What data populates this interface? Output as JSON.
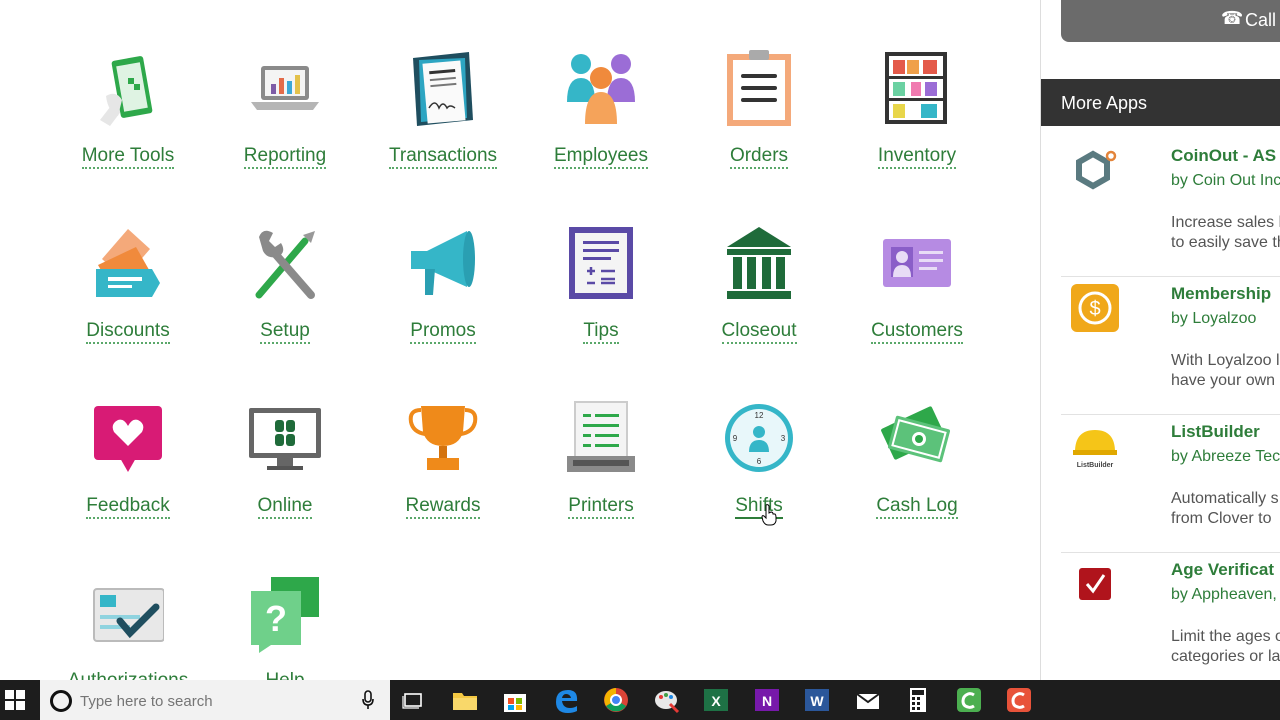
{
  "tools": [
    {
      "label": "More Tools"
    },
    {
      "label": "Reporting"
    },
    {
      "label": "Transactions"
    },
    {
      "label": "Employees"
    },
    {
      "label": "Orders"
    },
    {
      "label": "Inventory"
    },
    {
      "label": "Discounts"
    },
    {
      "label": "Setup"
    },
    {
      "label": "Promos"
    },
    {
      "label": "Tips"
    },
    {
      "label": "Closeout"
    },
    {
      "label": "Customers"
    },
    {
      "label": "Feedback"
    },
    {
      "label": "Online"
    },
    {
      "label": "Rewards"
    },
    {
      "label": "Printers"
    },
    {
      "label": "Shifts"
    },
    {
      "label": "Cash Log"
    },
    {
      "label": "Authorizations"
    },
    {
      "label": "Help"
    }
  ],
  "sidebar": {
    "call_label": "Call",
    "more_apps_title": "More Apps",
    "apps": [
      {
        "name": "CoinOut - AS",
        "by": "by Coin Out Inc",
        "desc1": "Increase sales l",
        "desc2": "to easily save th"
      },
      {
        "name": "Membership",
        "by": "by Loyalzoo",
        "desc1": "With Loyalzoo l",
        "desc2": "have your own"
      },
      {
        "name": "ListBuilder",
        "by": "by Abreeze Tec",
        "desc1": "Automatically s",
        "desc2": "from Clover to"
      },
      {
        "name": "Age Verificat",
        "by": "by Appheaven,",
        "desc1": "Limit the ages o",
        "desc2": "categories or la"
      }
    ],
    "listbuilder_logo_text": "ListBuilder"
  },
  "taskbar": {
    "search_placeholder": "Type here to search"
  },
  "colors": {
    "accent_green": "#2e7d3a",
    "header_dark": "#333333",
    "taskbar": "#1d1d1d"
  }
}
